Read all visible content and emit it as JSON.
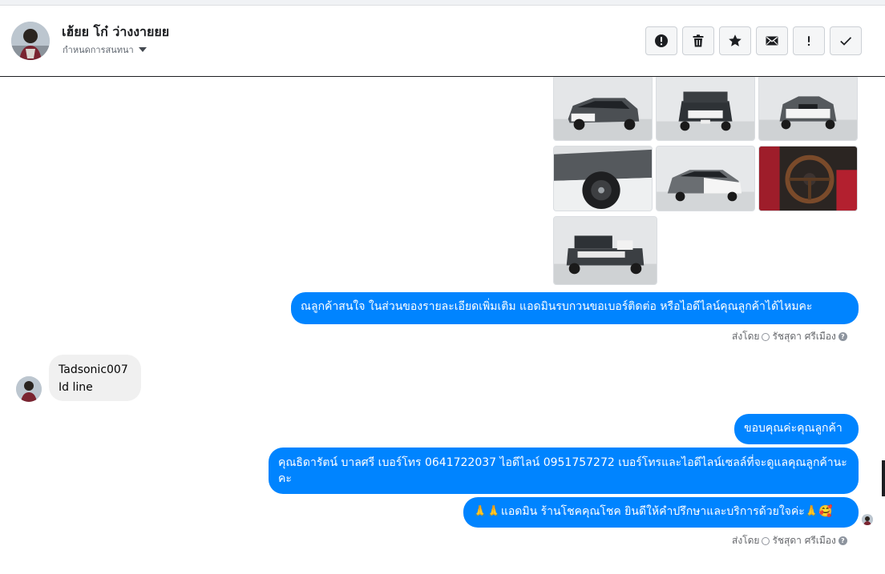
{
  "contact": {
    "name": "เฮ้ยย โก๋ ว่างงายยย",
    "assign_label": "กำหนดการสนทนา"
  },
  "toolbar": {
    "buttons": [
      {
        "name": "report-spam-button",
        "icon": "exclamation-circle-icon"
      },
      {
        "name": "delete-button",
        "icon": "trash-icon"
      },
      {
        "name": "star-button",
        "icon": "star-icon"
      },
      {
        "name": "mark-unread-button",
        "icon": "envelope-icon"
      },
      {
        "name": "follow-up-button",
        "icon": "exclamation-icon"
      },
      {
        "name": "mark-done-button",
        "icon": "checkmark-icon"
      }
    ]
  },
  "messages": {
    "m1": "ณลูกค้าสนใจ ในส่วนของรายละเอียดเพิ่มเติม แอดมินรบกวนขอเบอร์ติดต่อ หรือไอดีไลน์คุณลูกค้าได้ไหมคะ",
    "sent_by_1": {
      "prefix": "ส่งโดย",
      "agent": "รัชสุดา ศรีเมือง"
    },
    "in1_line1": "Tadsonic007",
    "in1_line2": "Id line",
    "m2": "ขอบคุณค่ะคุณลูกค้า",
    "m3": "คุณธิดารัตน์ บาลศรี เบอร์โทร 0641722037  ไอดีไลน์ 0951757272   เบอร์โทรและไอดีไลน์เซลล์ที่จะดูแลคุณลูกค้านะคะ",
    "m4": "🙏🙏แอดมิน ร้านโชคคุณโชค ยินดีให้คำปรึกษาและบริการด้วยใจค่ะ🙏🥰",
    "sent_by_2": {
      "prefix": "ส่งโดย",
      "agent": "รัชสุดา ศรีเมือง"
    }
  },
  "colors": {
    "outgoing": "#0084ff",
    "incoming": "#f0f0f0",
    "border": "#ccd0d5"
  }
}
